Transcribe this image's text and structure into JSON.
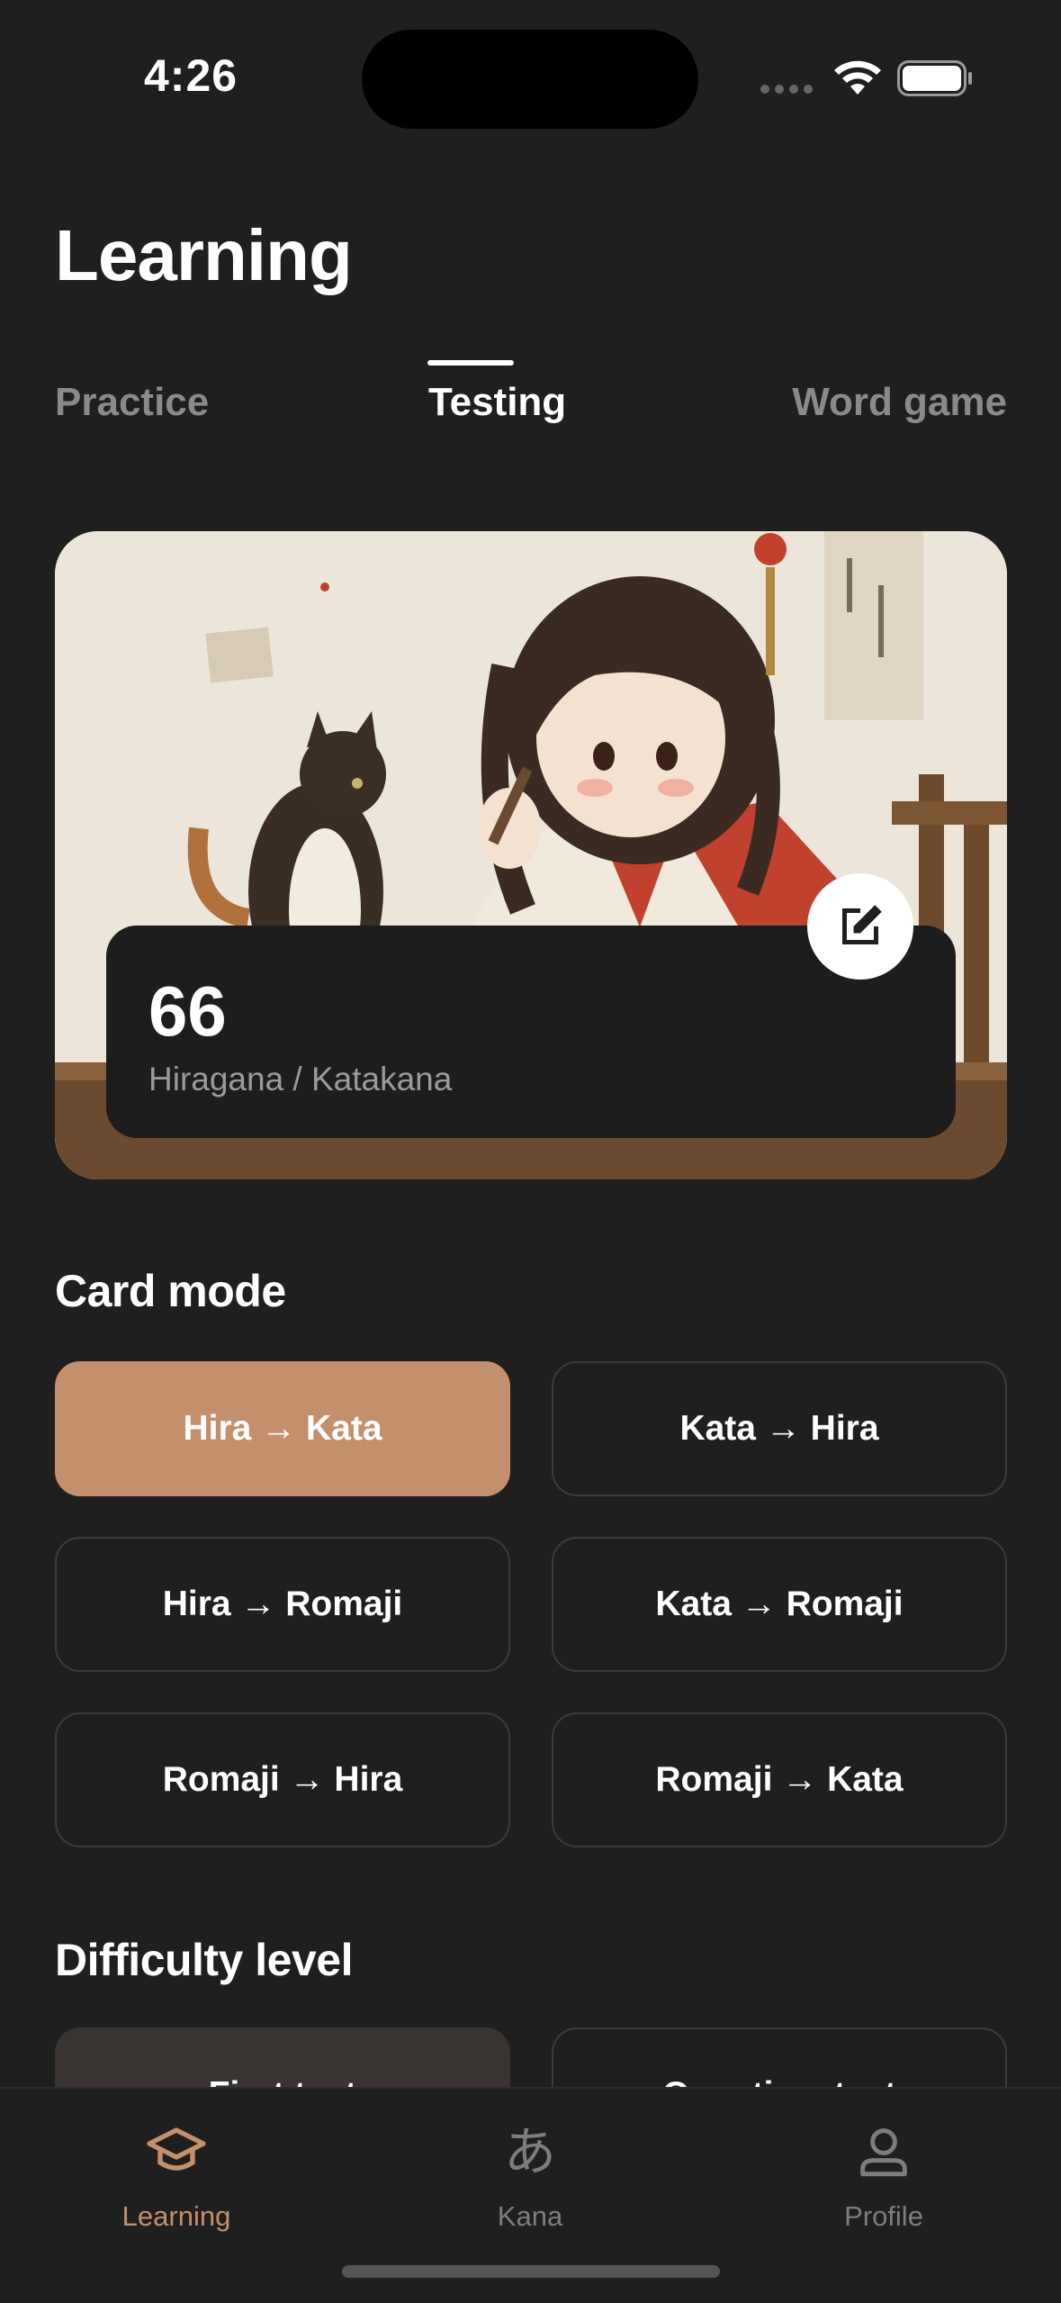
{
  "status_bar": {
    "time": "4:26"
  },
  "header": {
    "title": "Learning"
  },
  "tabs": [
    {
      "label": "Practice",
      "active": false
    },
    {
      "label": "Testing",
      "active": true
    },
    {
      "label": "Word game",
      "active": false
    }
  ],
  "hero": {
    "count": "66",
    "subtitle": "Hiragana / Katakana",
    "edit_icon": "edit-icon"
  },
  "card_mode": {
    "title": "Card mode",
    "options": [
      {
        "label": "Hira → Kata",
        "selected": true
      },
      {
        "label": "Kata → Hira",
        "selected": false
      },
      {
        "label": "Hira → Romaji",
        "selected": false
      },
      {
        "label": "Kata → Romaji",
        "selected": false
      },
      {
        "label": "Romaji → Hira",
        "selected": false
      },
      {
        "label": "Romaji → Kata",
        "selected": false
      }
    ]
  },
  "difficulty": {
    "title": "Difficulty level",
    "options": [
      {
        "label": "First test",
        "selected": true
      },
      {
        "label": "Over time test",
        "selected": false
      }
    ]
  },
  "bottom_nav": {
    "items": [
      {
        "label": "Learning",
        "icon": "graduation-cap-icon",
        "active": true
      },
      {
        "label": "Kana",
        "icon": "kana-icon",
        "glyph": "あ",
        "active": false
      },
      {
        "label": "Profile",
        "icon": "person-icon",
        "active": false
      }
    ]
  },
  "colors": {
    "background": "#1f1f1f",
    "accent": "#c48f6c",
    "muted_text": "#8a8a8a"
  }
}
